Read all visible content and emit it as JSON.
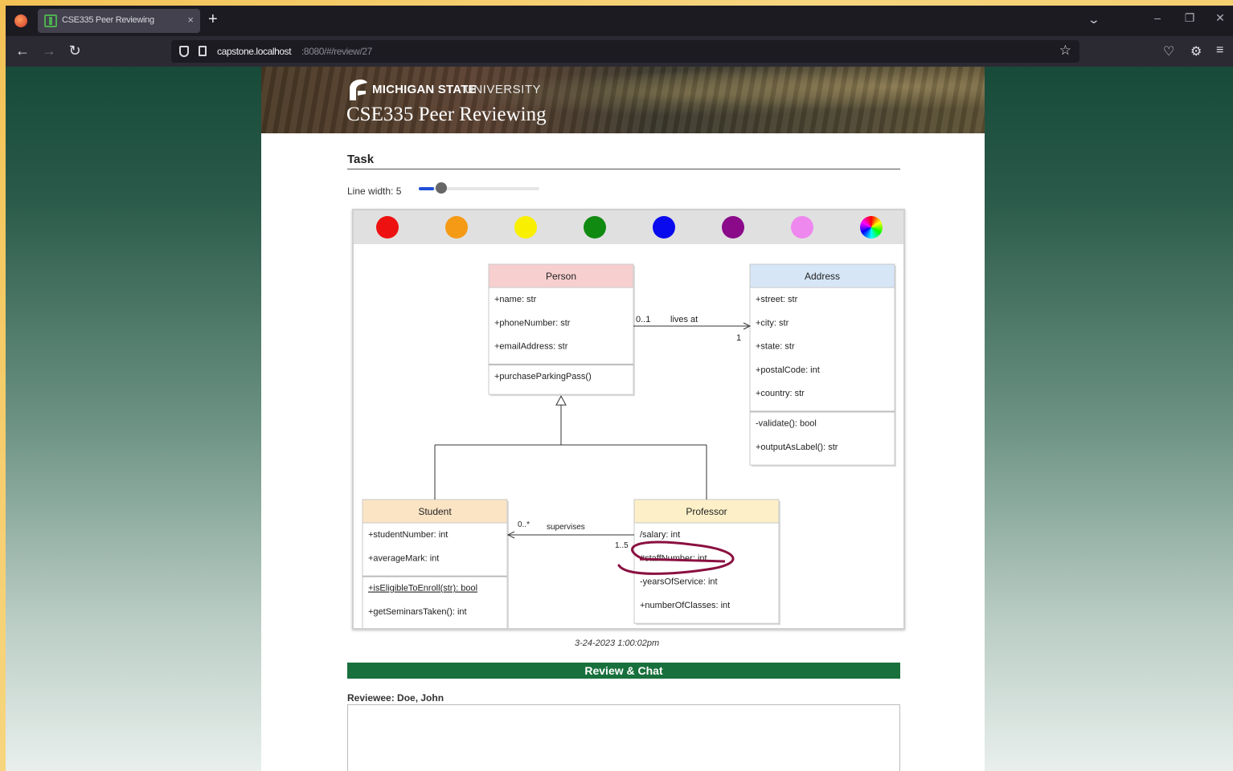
{
  "browser": {
    "tab_title": "CSE335 Peer Reviewing",
    "tab_close": "×",
    "new_tab": "+",
    "tabs_menu": "⌄",
    "url_host": "capstone.localhost",
    "url_path": ":8080/#/review/27",
    "nav_back": "←",
    "nav_forward": "→",
    "nav_reload": "↻",
    "bookmark_star": "☆",
    "pocket": "♡",
    "extensions": "⚙",
    "menu": "≡",
    "minimize": "–",
    "restore": "❐",
    "close": "✕"
  },
  "banner": {
    "university_bold": "MICHIGAN STATE",
    "university_light": "UNIVERSITY",
    "title": "CSE335 Peer Reviewing"
  },
  "task": {
    "heading": "Task",
    "line_width_label": "Line width:",
    "line_width_value": 5,
    "line_width_max": 50,
    "line_width_text": "5"
  },
  "palette": {
    "colors": [
      "#ee1111",
      "#f59a14",
      "#f8f000",
      "#118a11",
      "#0a0aee",
      "#8a0a8a",
      "#ee88ee"
    ],
    "rainbow": true
  },
  "diagram": {
    "classes": {
      "person": {
        "name": "Person",
        "attributes": [
          "+name: str",
          "+phoneNumber: str",
          "+emailAddress: str"
        ],
        "methods": [
          "+purchaseParkingPass()"
        ],
        "color": "#f7cfcf"
      },
      "address": {
        "name": "Address",
        "attributes": [
          "+street: str",
          "+city: str",
          "+state: str",
          "+postalCode: int",
          "+country: str"
        ],
        "methods": [
          "-validate(): bool",
          "+outputAsLabel(): str"
        ],
        "color": "#d6e6f7"
      },
      "student": {
        "name": "Student",
        "attributes": [
          "+studentNumber: int",
          "+averageMark: int"
        ],
        "methods": [
          "+isEligibleToEnroll(str): bool",
          "+getSeminarsTaken(): int"
        ],
        "color": "#fbe4c4"
      },
      "professor": {
        "name": "Professor",
        "attributes": [
          "/salary: int",
          "#staffNumber: int",
          "-yearsOfService: int",
          "+numberOfClasses: int"
        ],
        "methods": [],
        "color": "#fdf0c8"
      }
    },
    "associations": {
      "lives_at": {
        "label": "lives at",
        "mult_source": "0..1",
        "mult_target": "1"
      },
      "supervises": {
        "label": "supervises",
        "mult_source": "1..5",
        "mult_target": "0..*"
      }
    },
    "annotation_color": "#8a1040"
  },
  "timestamp": "3-24-2023 1:00:02pm",
  "review": {
    "bar_label": "Review & Chat",
    "reviewee_label": "Reviewee: Doe, John",
    "textarea_value": ""
  }
}
